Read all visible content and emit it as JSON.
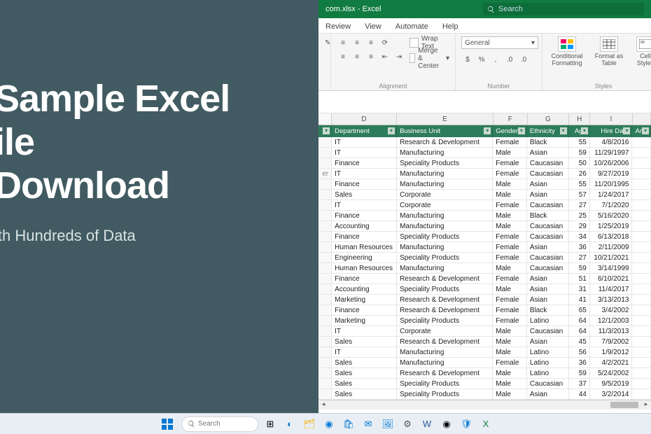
{
  "promo": {
    "title_l1": "Sample Excel",
    "title_l2": "ile",
    "title_l3": "Download",
    "subtitle": "ith Hundreds of Data"
  },
  "titlebar": {
    "filename": "com.xlsx - Excel",
    "search_placeholder": "Search"
  },
  "tabs": [
    "Review",
    "View",
    "Automate",
    "Help"
  ],
  "ribbon": {
    "wrap": "Wrap Text",
    "merge": "Merge & Center",
    "align_label": "Alignment",
    "numfmt": "General",
    "num_label": "Number",
    "cf": "Conditional Formatting",
    "fat": "Format as Table",
    "cs": "Cell Styles",
    "styles_label": "Styles"
  },
  "columns": {
    "D": "Department",
    "E": "Business Unit",
    "F": "Gender",
    "G": "Ethnicity",
    "H": "Age",
    "I": "Hire Date",
    "J": "Ann"
  },
  "col_letters": [
    "D",
    "E",
    "F",
    "G",
    "H",
    "I"
  ],
  "rows": [
    {
      "left": "",
      "d": "IT",
      "e": "Research & Development",
      "f": "Female",
      "g": "Black",
      "h": "55",
      "i": "4/8/2016"
    },
    {
      "left": "",
      "d": "IT",
      "e": "Manufacturing",
      "f": "Male",
      "g": "Asian",
      "h": "59",
      "i": "11/29/1997"
    },
    {
      "left": "",
      "d": "Finance",
      "e": "Speciality Products",
      "f": "Female",
      "g": "Caucasian",
      "h": "50",
      "i": "10/26/2006"
    },
    {
      "left": "er",
      "d": "IT",
      "e": "Manufacturing",
      "f": "Female",
      "g": "Caucasian",
      "h": "26",
      "i": "9/27/2019"
    },
    {
      "left": "",
      "d": "Finance",
      "e": "Manufacturing",
      "f": "Male",
      "g": "Asian",
      "h": "55",
      "i": "11/20/1995"
    },
    {
      "left": "",
      "d": "Sales",
      "e": "Corporate",
      "f": "Male",
      "g": "Asian",
      "h": "57",
      "i": "1/24/2017"
    },
    {
      "left": "",
      "d": "IT",
      "e": "Corporate",
      "f": "Female",
      "g": "Caucasian",
      "h": "27",
      "i": "7/1/2020"
    },
    {
      "left": "",
      "d": "Finance",
      "e": "Manufacturing",
      "f": "Male",
      "g": "Black",
      "h": "25",
      "i": "5/16/2020"
    },
    {
      "left": "",
      "d": "Accounting",
      "e": "Manufacturing",
      "f": "Male",
      "g": "Caucasian",
      "h": "29",
      "i": "1/25/2019"
    },
    {
      "left": "",
      "d": "Finance",
      "e": "Speciality Products",
      "f": "Female",
      "g": "Caucasian",
      "h": "34",
      "i": "6/13/2018"
    },
    {
      "left": "",
      "d": "Human Resources",
      "e": "Manufacturing",
      "f": "Female",
      "g": "Asian",
      "h": "36",
      "i": "2/11/2009"
    },
    {
      "left": "",
      "d": "Engineering",
      "e": "Speciality Products",
      "f": "Female",
      "g": "Caucasian",
      "h": "27",
      "i": "10/21/2021"
    },
    {
      "left": "",
      "d": "Human Resources",
      "e": "Manufacturing",
      "f": "Male",
      "g": "Caucasian",
      "h": "59",
      "i": "3/14/1999"
    },
    {
      "left": "",
      "d": "Finance",
      "e": "Research & Development",
      "f": "Female",
      "g": "Asian",
      "h": "51",
      "i": "6/10/2021"
    },
    {
      "left": "",
      "d": "Accounting",
      "e": "Speciality Products",
      "f": "Male",
      "g": "Asian",
      "h": "31",
      "i": "11/4/2017"
    },
    {
      "left": "",
      "d": "Marketing",
      "e": "Research & Development",
      "f": "Female",
      "g": "Asian",
      "h": "41",
      "i": "3/13/2013"
    },
    {
      "left": "",
      "d": "Finance",
      "e": "Research & Development",
      "f": "Female",
      "g": "Black",
      "h": "65",
      "i": "3/4/2002"
    },
    {
      "left": "",
      "d": "Marketing",
      "e": "Speciality Products",
      "f": "Female",
      "g": "Latino",
      "h": "64",
      "i": "12/1/2003"
    },
    {
      "left": "",
      "d": "IT",
      "e": "Corporate",
      "f": "Male",
      "g": "Caucasian",
      "h": "64",
      "i": "11/3/2013"
    },
    {
      "left": "",
      "d": "Sales",
      "e": "Research & Development",
      "f": "Male",
      "g": "Asian",
      "h": "45",
      "i": "7/9/2002"
    },
    {
      "left": "",
      "d": "IT",
      "e": "Manufacturing",
      "f": "Male",
      "g": "Latino",
      "h": "56",
      "i": "1/9/2012"
    },
    {
      "left": "",
      "d": "Sales",
      "e": "Manufacturing",
      "f": "Female",
      "g": "Latino",
      "h": "36",
      "i": "4/2/2021"
    },
    {
      "left": "",
      "d": "Sales",
      "e": "Research & Development",
      "f": "Male",
      "g": "Latino",
      "h": "59",
      "i": "5/24/2002"
    },
    {
      "left": "",
      "d": "Sales",
      "e": "Speciality Products",
      "f": "Male",
      "g": "Caucasian",
      "h": "37",
      "i": "9/5/2019"
    },
    {
      "left": "",
      "d": "Sales",
      "e": "Speciality Products",
      "f": "Male",
      "g": "Asian",
      "h": "44",
      "i": "3/2/2014"
    }
  ],
  "taskbar": {
    "search": "Search"
  }
}
